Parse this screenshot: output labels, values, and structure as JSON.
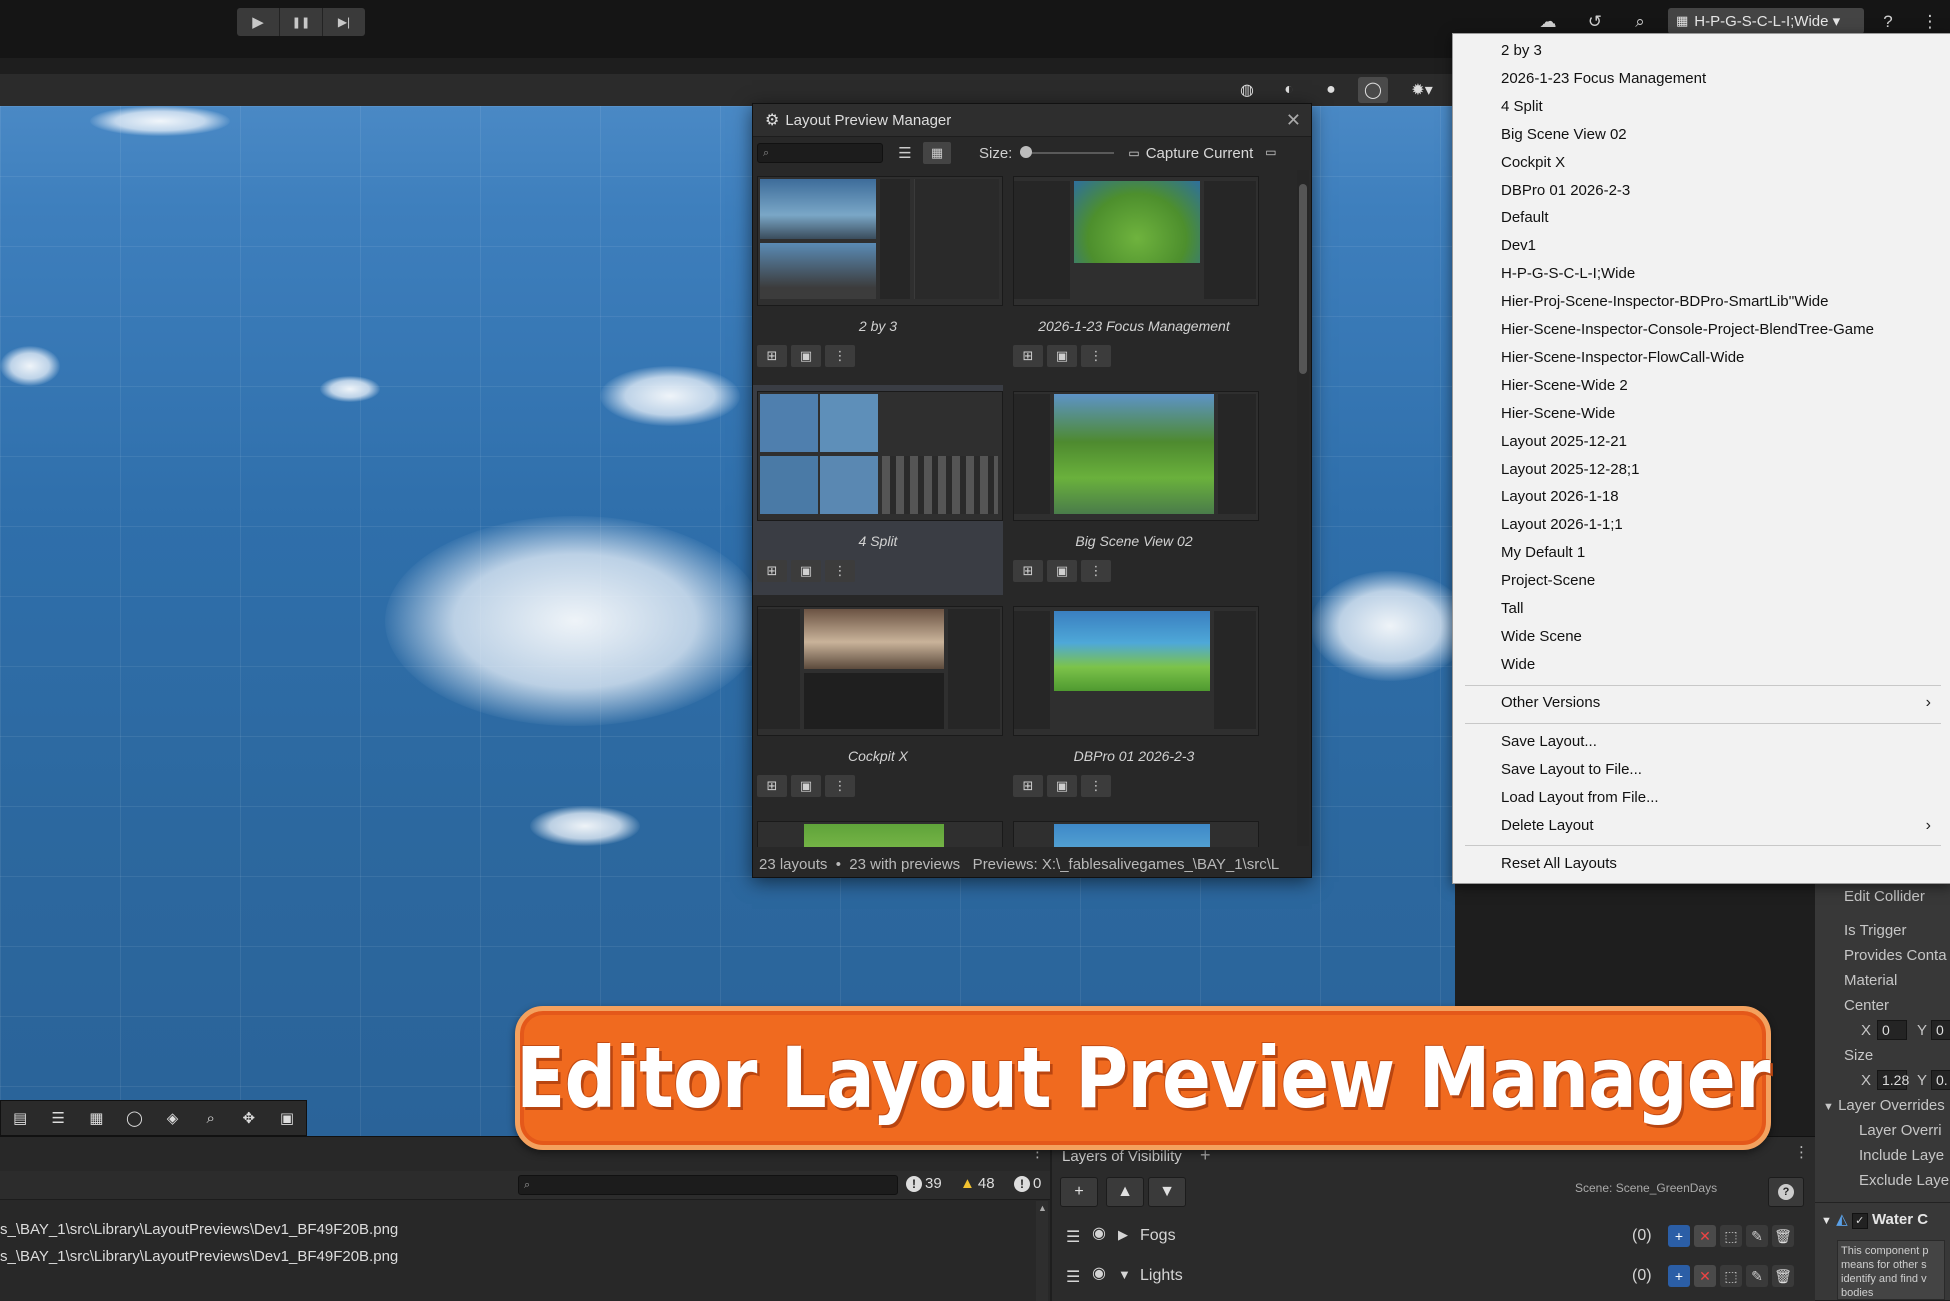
{
  "toolbar": {
    "play_icon": "▶",
    "pause_icon": "❚❚",
    "step_icon": "▶|",
    "layout_dropdown": "H-P-G-S-C-L-I;Wide ▾"
  },
  "lpm": {
    "title": "Layout Preview Manager",
    "size_label": "Size:",
    "capture_label": "Capture Current",
    "thumbnails": [
      "2 by 3",
      "2026-1-23 Focus Management",
      "4 Split",
      "Big Scene View 02",
      "Cockpit X",
      "DBPro 01 2026-2-3"
    ],
    "status": "23 layouts  •  23 with previews   Previews: X:\\_fablesalivegames_\\BAY_1\\src\\L"
  },
  "menu": {
    "layouts": [
      "2 by 3",
      "2026-1-23 Focus Management",
      "4 Split",
      "Big Scene View 02",
      "Cockpit X",
      "DBPro 01 2026-2-3",
      "Default",
      "Dev1",
      "H-P-G-S-C-L-I;Wide",
      "Hier-Proj-Scene-Inspector-BDPro-SmartLib''Wide",
      "Hier-Scene-Inspector-Console-Project-BlendTree-Game",
      "Hier-Scene-Inspector-FlowCall-Wide",
      "Hier-Scene-Wide 2",
      "Hier-Scene-Wide",
      "Layout 2025-12-21",
      "Layout 2025-12-28;1",
      "Layout 2026-1-18",
      "Layout 2026-1-1;1",
      "My Default 1",
      "Project-Scene",
      "Tall",
      "Wide Scene",
      "Wide"
    ],
    "other_versions": "Other Versions",
    "save_layout": "Save Layout...",
    "save_layout_file": "Save Layout to File...",
    "load_layout_file": "Load Layout from File...",
    "delete_layout": "Delete Layout",
    "reset_all": "Reset All Layouts"
  },
  "banner": {
    "text": "Editor Layout Preview Manager"
  },
  "console": {
    "count_info": "39",
    "count_warn": "48",
    "count_err": "0",
    "lines": [
      "s_\\BAY_1\\src\\Library\\LayoutPreviews\\Dev1_BF49F20B.png",
      "s_\\BAY_1\\src\\Library\\LayoutPreviews\\Dev1_BF49F20B.png"
    ]
  },
  "layers": {
    "tab": "Layers of Visibility",
    "scene_label": "Scene: Scene_GreenDays",
    "rows": [
      {
        "name": "Fogs",
        "count": "(0)"
      },
      {
        "name": "Lights",
        "count": "(0)"
      }
    ]
  },
  "inspector": {
    "edit_collider": "Edit Collider",
    "is_trigger": "Is Trigger",
    "provides_contacts": "Provides Conta",
    "material": "Material",
    "center": "Center",
    "x_label": "X",
    "y_label": "Y",
    "center_x": "0",
    "center_y": "0",
    "size": "Size",
    "size_x": "1.28",
    "size_y": "0.",
    "layer_overrides": "Layer Overrides",
    "layer_override_priority": "Layer Overri",
    "include_layers": "Include Laye",
    "exclude_layers": "Exclude Laye",
    "water_component": "Water C",
    "description": "This component p means for other s identify and find v bodies"
  }
}
